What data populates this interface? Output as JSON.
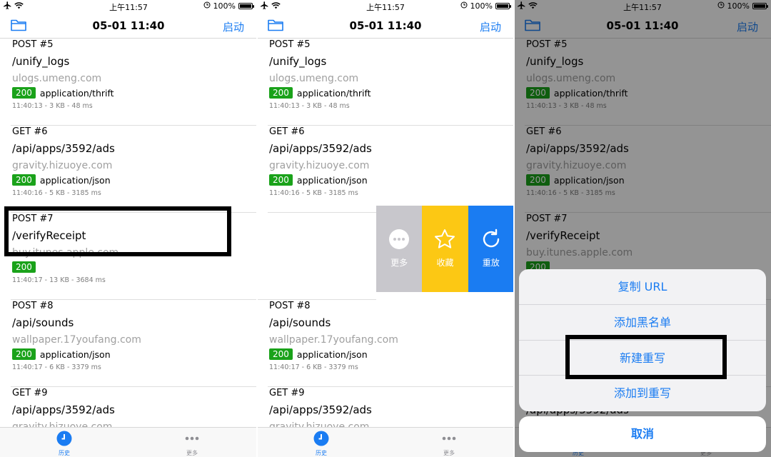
{
  "status": {
    "time": "上午11:57",
    "battery": "100%"
  },
  "nav": {
    "title": "05-01 11:40",
    "start_label": "启动"
  },
  "rows": [
    {
      "method_num": "POST  #5",
      "path": "/unify_logs",
      "host": "ulogs.umeng.com",
      "code": "200",
      "type": "application/thrift",
      "meta": "11:40:13 - 3 KB - 48 ms"
    },
    {
      "method_num": "GET  #6",
      "path": "/api/apps/3592/ads",
      "host": "gravity.hizuoye.com",
      "code": "200",
      "type": "application/json",
      "meta": "11:40:16 - 5 KB - 3185 ms"
    },
    {
      "method_num": "POST  #7",
      "path": "/verifyReceipt",
      "host": "buy.itunes.apple.com",
      "code": "200",
      "type": "",
      "meta": "11:40:17 - 13 KB - 3684 ms"
    },
    {
      "method_num": "POST  #8",
      "path": "/api/sounds",
      "host": "wallpaper.17youfang.com",
      "code": "200",
      "type": "application/json",
      "meta": "11:40:17 - 6 KB - 3379 ms"
    },
    {
      "method_num": "GET  #9",
      "path": "/api/apps/3592/ads",
      "host": "gravity.hizuoye.com",
      "code": "",
      "type": "",
      "meta": ""
    }
  ],
  "tabs": {
    "history": "历史",
    "more": "更多"
  },
  "swipe_actions": {
    "more": "更多",
    "favorite": "收藏",
    "replay": "重放"
  },
  "action_sheet": {
    "items": [
      "复制 URL",
      "添加黑名单",
      "新建重写",
      "添加到重写"
    ],
    "cancel": "取消"
  },
  "colors": {
    "accent": "#1a7cf2",
    "status_200": "#1aa21a",
    "favorite": "#fcc814",
    "more": "#c8c7cc"
  },
  "icons": {
    "plane": "airplane-icon",
    "wifi": "wifi-icon",
    "folder": "folder-icon",
    "clock": "clock-icon",
    "ellipsis": "ellipsis-icon",
    "star": "star-icon",
    "replay": "replay-icon"
  }
}
